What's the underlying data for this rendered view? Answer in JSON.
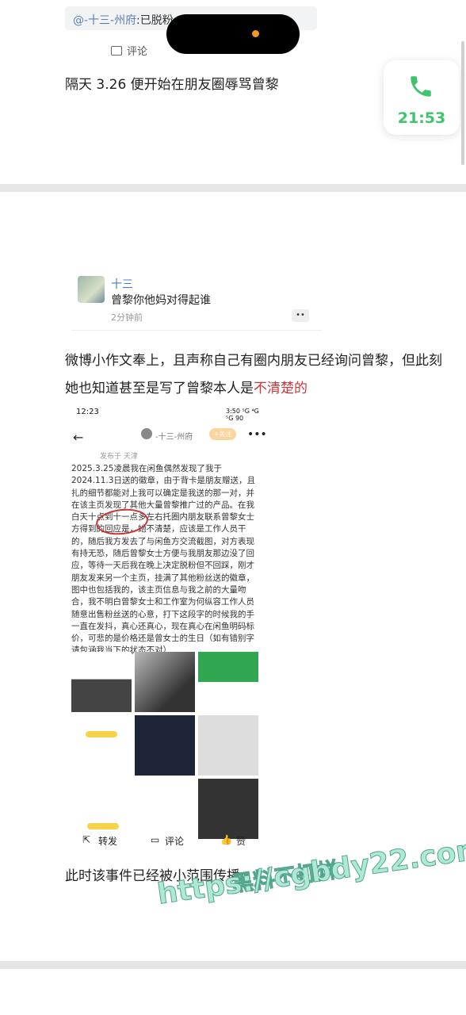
{
  "top_quote": {
    "user": "@-十三-州府",
    "rest": ":已脱粉"
  },
  "comment_label": "评论",
  "call": {
    "time": "21:53"
  },
  "para1": "隔天 3.26 便开始在朋友圈辱骂曾黎",
  "weibo_card": {
    "name": "十三",
    "text": "曾黎你他妈对得起谁",
    "time": "2分钟前",
    "more": "••"
  },
  "para2_part1": "微博小作文奉上，且声称自己有圈内朋友已经询问曾黎，但此刻她也知道甚至是写了曾黎本人是",
  "para2_red": "不清楚的",
  "screenshot": {
    "status_time": "12:23",
    "status_right": "3:50 ⁵G ⁴G ⁵G 90",
    "back": "←",
    "user": "-十三-州府",
    "follow": "+关注",
    "more": "•••",
    "from": "发布于 天津",
    "body": "2025.3.25凌晨我在闲鱼偶然发现了我于2024.11.3日送的徽章，由于背卡是朋友赠送，且扎的细节都能对上我可以确定是我送的那一对，并在该主页发现了其他大量曾黎推广过的产品。在我白天十点到十一点多左右托圈内朋友联系曾黎女士方得到的回应是，她不清楚，应该是工作人员干的，随后我方发去了与闲鱼方交流截图，对方表现有持无恐，随后曾黎女士方便与我朋友那边没了回应，等待一天后我在晚上决定脱粉但不回踩，刚才朋友发来另一个主页，挂满了其他粉丝送的徽章，图中也包括我的，该主页信息与我之前的大量吻合，我不明白曾黎女士和工作室为何纵容工作人员随意出售粉丝送的心意，打下这段字的时候我的手一直在发抖，真心还真心，现在真心在闲鱼明码标价，可悲的是价格还是曾女士的生日（如有错别字请包涵我当下的状态不对）",
    "actions": {
      "repost": "转发",
      "comment": "评论",
      "like": "赞"
    }
  },
  "para3": "此时该事件已经被小范围传播",
  "watermark": {
    "line1": "黑料不打烊",
    "line2": "https://cgbdy22.com"
  }
}
